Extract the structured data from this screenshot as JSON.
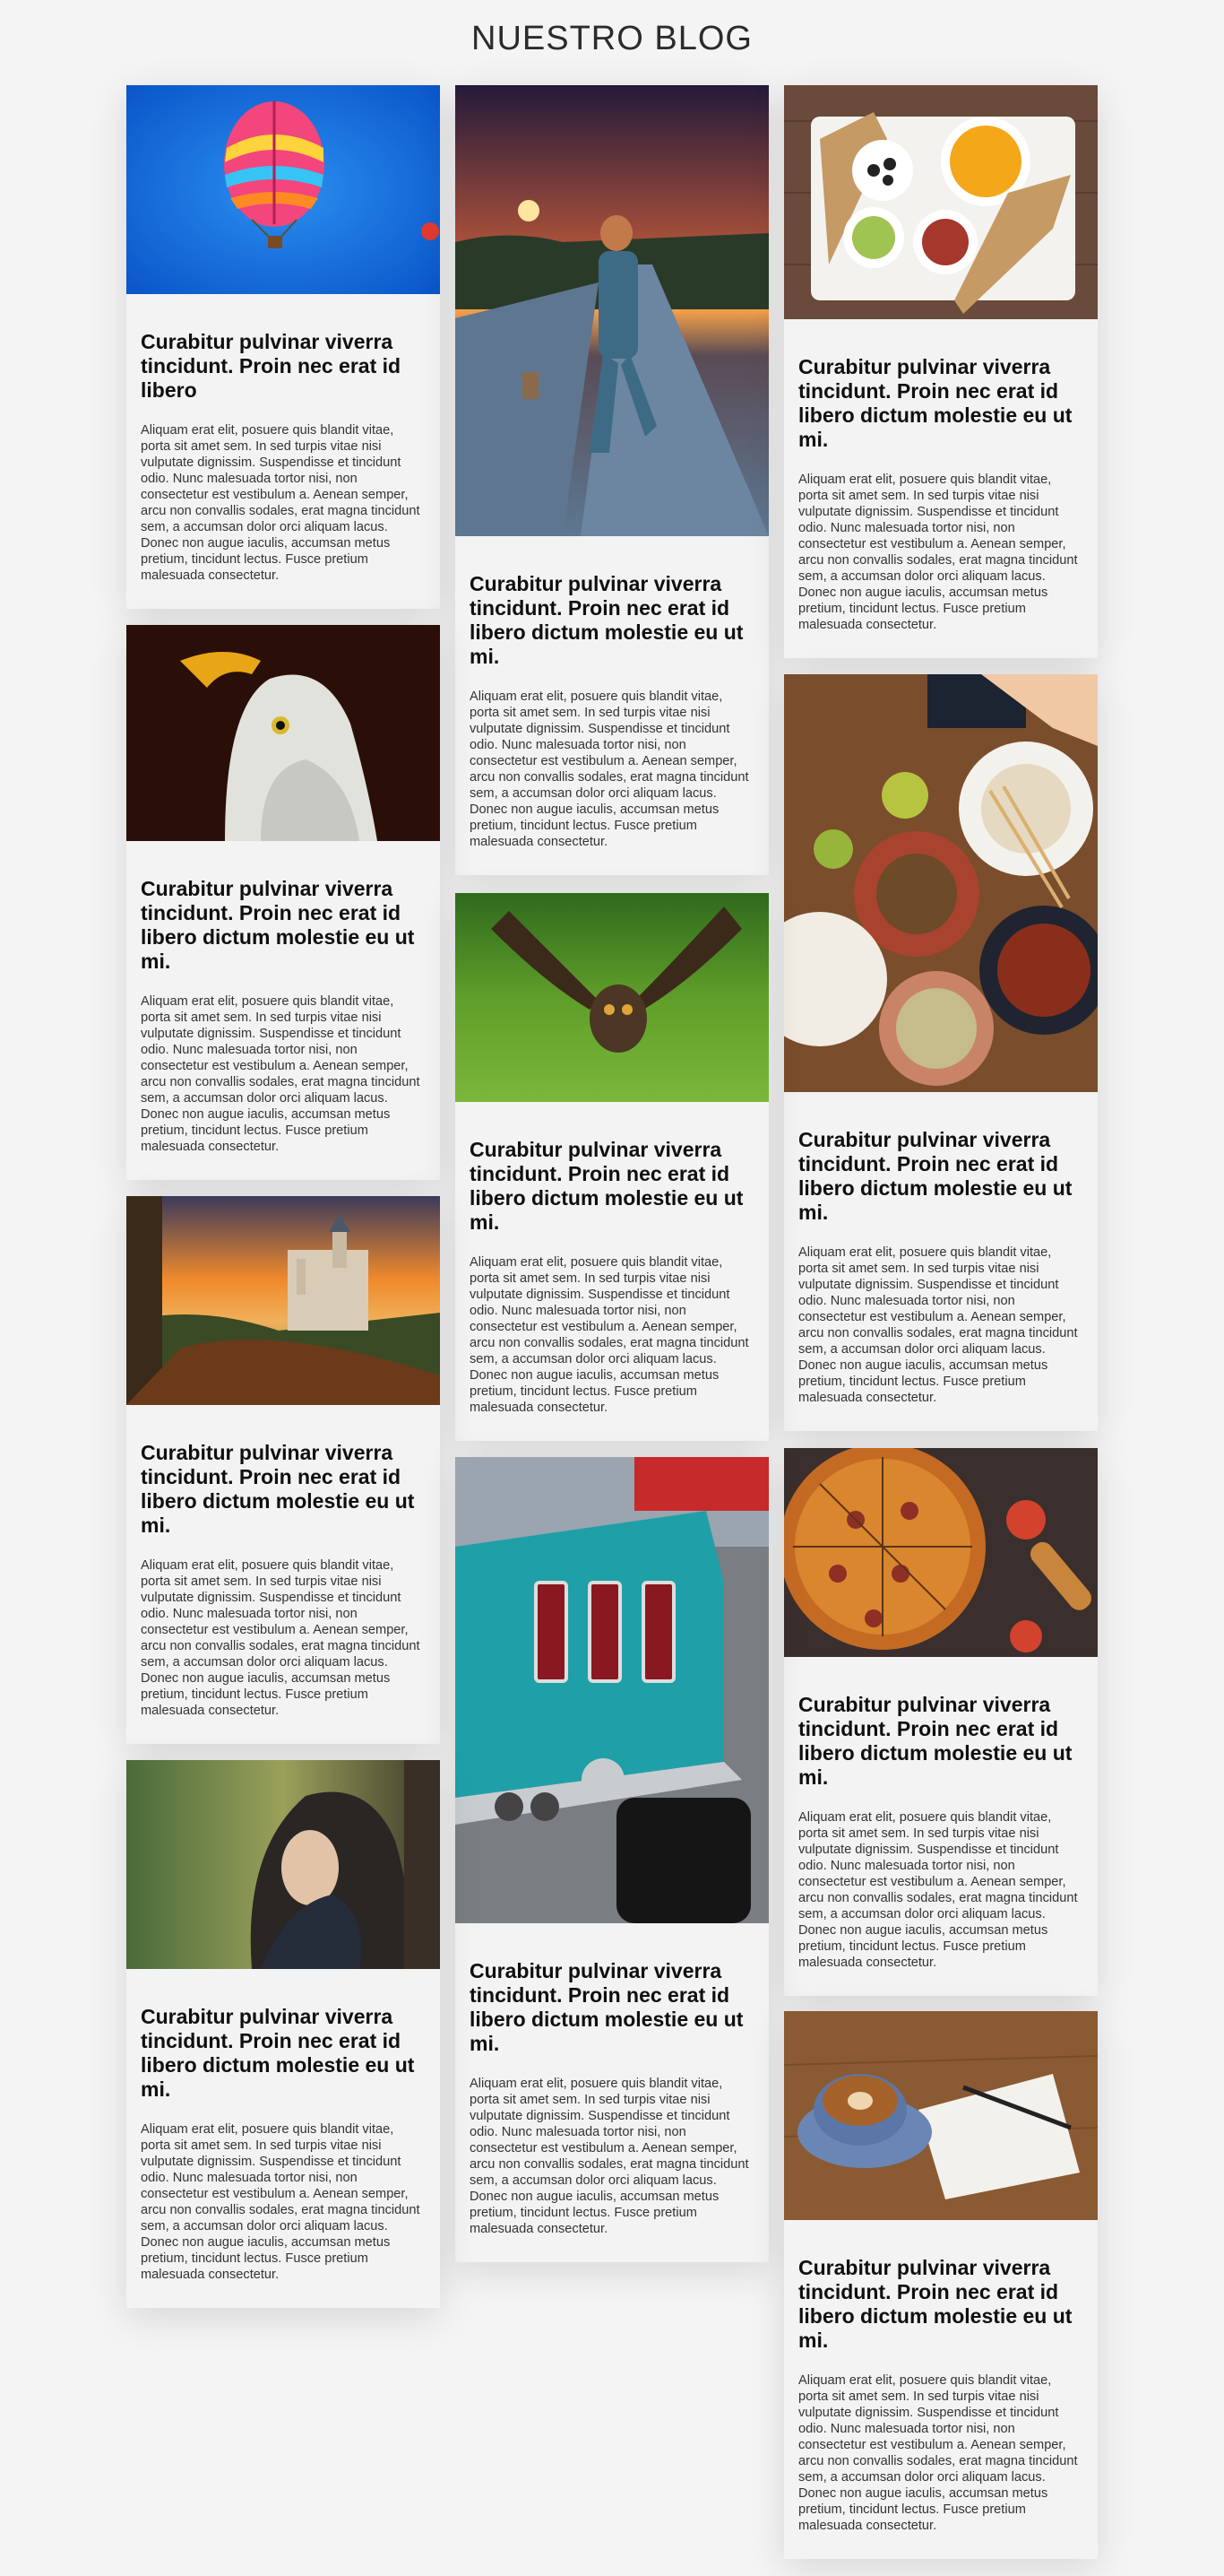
{
  "page": {
    "title": "NUESTRO BLOG"
  },
  "posts": [
    {
      "image_alt": "hot-air-balloon",
      "title": "Curabitur pulvinar viverra tincidunt. Proin nec erat id libero",
      "excerpt": "Aliquam erat elit, posuere quis blandit vitae, porta sit amet sem. In sed turpis vitae nisi vulputate dignissim. Suspendisse et tincidunt odio. Nunc malesuada tortor nisi, non consectetur est vestibulum a. Aenean semper, arcu non convallis sodales, erat magna tincidunt sem, a accumsan dolor orci aliquam lacus. Donec non augue iaculis, accumsan metus pretium, tincidunt lectus. Fusce pretium malesuada consectetur."
    },
    {
      "image_alt": "girl-on-road",
      "title": "Curabitur pulvinar viverra tincidunt. Proin nec erat id libero dictum molestie eu ut mi.",
      "excerpt": "Aliquam erat elit, posuere quis blandit vitae, porta sit amet sem. In sed turpis vitae nisi vulputate dignissim. Suspendisse et tincidunt odio. Nunc malesuada tortor nisi, non consectetur est vestibulum a. Aenean semper, arcu non convallis sodales, erat magna tincidunt sem, a accumsan dolor orci aliquam lacus. Donec non augue iaculis, accumsan metus pretium, tincidunt lectus. Fusce pretium malesuada consectetur."
    },
    {
      "image_alt": "breakfast-plate",
      "title": "Curabitur pulvinar viverra tincidunt. Proin nec erat id libero dictum molestie eu ut mi.",
      "excerpt": "Aliquam erat elit, posuere quis blandit vitae, porta sit amet sem. In sed turpis vitae nisi vulputate dignissim. Suspendisse et tincidunt odio. Nunc malesuada tortor nisi, non consectetur est vestibulum a. Aenean semper, arcu non convallis sodales, erat magna tincidunt sem, a accumsan dolor orci aliquam lacus. Donec non augue iaculis, accumsan metus pretium, tincidunt lectus. Fusce pretium malesuada consectetur."
    },
    {
      "image_alt": "eagle",
      "title": "Curabitur pulvinar viverra tincidunt. Proin nec erat id libero dictum molestie eu ut mi.",
      "excerpt": "Aliquam erat elit, posuere quis blandit vitae, porta sit amet sem. In sed turpis vitae nisi vulputate dignissim. Suspendisse et tincidunt odio. Nunc malesuada tortor nisi, non consectetur est vestibulum a. Aenean semper, arcu non convallis sodales, erat magna tincidunt sem, a accumsan dolor orci aliquam lacus. Donec non augue iaculis, accumsan metus pretium, tincidunt lectus. Fusce pretium malesuada consectetur."
    },
    {
      "image_alt": "asian-food-table",
      "title": "Curabitur pulvinar viverra tincidunt. Proin nec erat id libero dictum molestie eu ut mi.",
      "excerpt": "Aliquam erat elit, posuere quis blandit vitae, porta sit amet sem. In sed turpis vitae nisi vulputate dignissim. Suspendisse et tincidunt odio. Nunc malesuada tortor nisi, non consectetur est vestibulum a. Aenean semper, arcu non convallis sodales, erat magna tincidunt sem, a accumsan dolor orci aliquam lacus. Donec non augue iaculis, accumsan metus pretium, tincidunt lectus. Fusce pretium malesuada consectetur."
    },
    {
      "image_alt": "owl-flying",
      "title": "Curabitur pulvinar viverra tincidunt. Proin nec erat id libero dictum molestie eu ut mi.",
      "excerpt": "Aliquam erat elit, posuere quis blandit vitae, porta sit amet sem. In sed turpis vitae nisi vulputate dignissim. Suspendisse et tincidunt odio. Nunc malesuada tortor nisi, non consectetur est vestibulum a. Aenean semper, arcu non convallis sodales, erat magna tincidunt sem, a accumsan dolor orci aliquam lacus. Donec non augue iaculis, accumsan metus pretium, tincidunt lectus. Fusce pretium malesuada consectetur."
    },
    {
      "image_alt": "castle-sunset",
      "title": "Curabitur pulvinar viverra tincidunt. Proin nec erat id libero dictum molestie eu ut mi.",
      "excerpt": "Aliquam erat elit, posuere quis blandit vitae, porta sit amet sem. In sed turpis vitae nisi vulputate dignissim. Suspendisse et tincidunt odio. Nunc malesuada tortor nisi, non consectetur est vestibulum a. Aenean semper, arcu non convallis sodales, erat magna tincidunt sem, a accumsan dolor orci aliquam lacus. Donec non augue iaculis, accumsan metus pretium, tincidunt lectus. Fusce pretium malesuada consectetur."
    },
    {
      "image_alt": "pizza",
      "title": "Curabitur pulvinar viverra tincidunt. Proin nec erat id libero dictum molestie eu ut mi.",
      "excerpt": "Aliquam erat elit, posuere quis blandit vitae, porta sit amet sem. In sed turpis vitae nisi vulputate dignissim. Suspendisse et tincidunt odio. Nunc malesuada tortor nisi, non consectetur est vestibulum a. Aenean semper, arcu non convallis sodales, erat magna tincidunt sem, a accumsan dolor orci aliquam lacus. Donec non augue iaculis, accumsan metus pretium, tincidunt lectus. Fusce pretium malesuada consectetur."
    },
    {
      "image_alt": "classic-car",
      "title": "Curabitur pulvinar viverra tincidunt. Proin nec erat id libero dictum molestie eu ut mi.",
      "excerpt": "Aliquam erat elit, posuere quis blandit vitae, porta sit amet sem. In sed turpis vitae nisi vulputate dignissim. Suspendisse et tincidunt odio. Nunc malesuada tortor nisi, non consectetur est vestibulum a. Aenean semper, arcu non convallis sodales, erat magna tincidunt sem, a accumsan dolor orci aliquam lacus. Donec non augue iaculis, accumsan metus pretium, tincidunt lectus. Fusce pretium malesuada consectetur."
    },
    {
      "image_alt": "woman-scarf",
      "title": "Curabitur pulvinar viverra tincidunt. Proin nec erat id libero dictum molestie eu ut mi.",
      "excerpt": "Aliquam erat elit, posuere quis blandit vitae, porta sit amet sem. In sed turpis vitae nisi vulputate dignissim. Suspendisse et tincidunt odio. Nunc malesuada tortor nisi, non consectetur est vestibulum a. Aenean semper, arcu non convallis sodales, erat magna tincidunt sem, a accumsan dolor orci aliquam lacus. Donec non augue iaculis, accumsan metus pretium, tincidunt lectus. Fusce pretium malesuada consectetur."
    },
    {
      "image_alt": "coffee-notebook",
      "title": "Curabitur pulvinar viverra tincidunt. Proin nec erat id libero dictum molestie eu ut mi.",
      "excerpt": "Aliquam erat elit, posuere quis blandit vitae, porta sit amet sem. In sed turpis vitae nisi vulputate dignissim. Suspendisse et tincidunt odio. Nunc malesuada tortor nisi, non consectetur est vestibulum a. Aenean semper, arcu non convallis sodales, erat magna tincidunt sem, a accumsan dolor orci aliquam lacus. Donec non augue iaculis, accumsan metus pretium, tincidunt lectus. Fusce pretium malesuada consectetur."
    }
  ]
}
